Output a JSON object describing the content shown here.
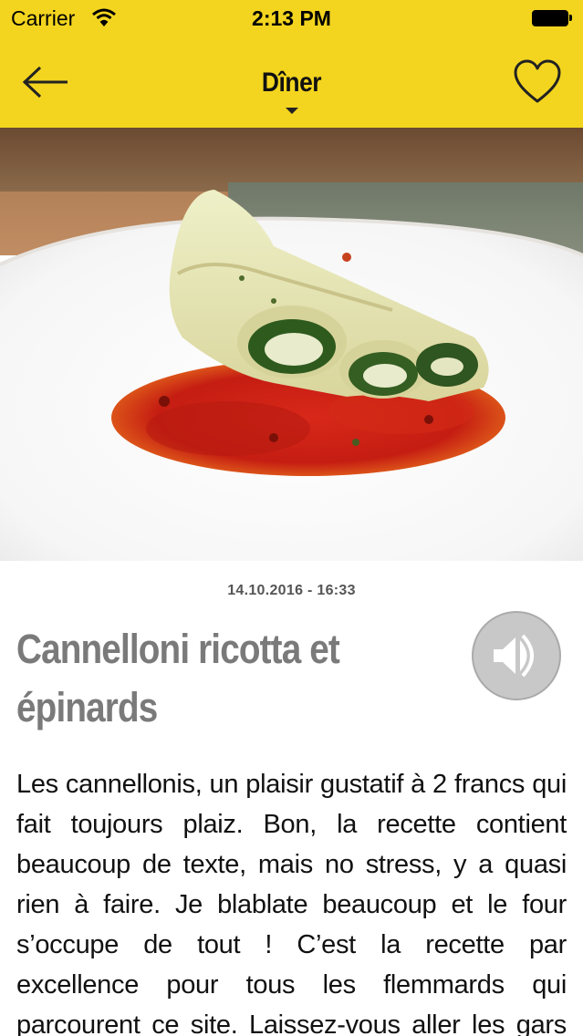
{
  "status_bar": {
    "carrier": "Carrier",
    "time": "2:13 PM"
  },
  "nav": {
    "title": "Dîner",
    "back_icon": "arrow-left-icon",
    "favorite_icon": "heart-outline-icon",
    "dropdown_icon": "caret-down-icon"
  },
  "hero": {
    "image_icon": "dish-photo"
  },
  "article": {
    "date": "14.10.2016 - 16:33",
    "title": "Cannelloni ricotta et épinards",
    "audio_icon": "speaker-icon",
    "body": "Les cannellonis, un plaisir gustatif à 2 francs qui fait toujours plaiz. Bon, la recette contient beaucoup de texte, mais no stress, y a quasi rien à faire. Je blablate beaucoup et le four s’occupe de tout ! C’est la recette par excellence pour tous les flemmards qui parcourent ce site. Laissez-vous aller les gars et faites-vous plaisir"
  },
  "colors": {
    "header_bg": "#f3d51f",
    "title_gray": "#7a7a7a",
    "audio_btn": "#c8c8c8"
  }
}
